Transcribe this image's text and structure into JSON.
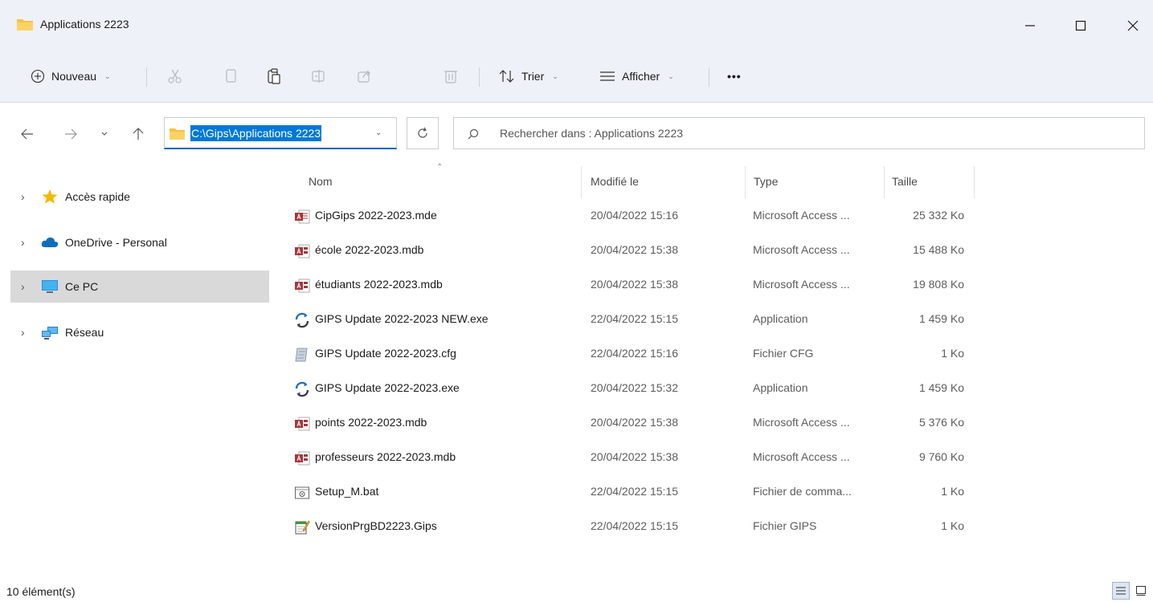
{
  "window": {
    "title": "Applications 2223",
    "minimize_icon": "minimize-icon",
    "maximize_icon": "maximize-icon",
    "close_icon": "close-icon"
  },
  "toolbar": {
    "new_label": "Nouveau",
    "sort_label": "Trier",
    "view_label": "Afficher",
    "more_label": "•••",
    "icons": [
      "plus-circle-icon",
      "cut-icon",
      "copy-icon",
      "paste-icon",
      "rename-icon",
      "share-icon",
      "delete-icon",
      "sort-icon",
      "view-icon",
      "more-icon"
    ]
  },
  "navigation": {
    "address": "C:\\Gips\\Applications 2223",
    "search_placeholder": "Rechercher dans : Applications 2223"
  },
  "sidebar": {
    "items": [
      {
        "label": "Accès rapide",
        "icon": "star-icon"
      },
      {
        "label": "OneDrive - Personal",
        "icon": "cloud-icon"
      },
      {
        "label": "Ce PC",
        "icon": "computer-icon",
        "selected": true
      },
      {
        "label": "Réseau",
        "icon": "network-icon"
      }
    ]
  },
  "file_list": {
    "columns": {
      "name": "Nom",
      "modified": "Modifié le",
      "type": "Type",
      "size": "Taille"
    },
    "files": [
      {
        "name": "CipGips 2022-2023.mde",
        "modified": "20/04/2022 15:16",
        "type": "Microsoft Access ...",
        "size": "25 332 Ko",
        "icon": "access-mde-icon"
      },
      {
        "name": "école 2022-2023.mdb",
        "modified": "20/04/2022 15:38",
        "type": "Microsoft Access ...",
        "size": "15 488 Ko",
        "icon": "access-mdb-icon"
      },
      {
        "name": "étudiants 2022-2023.mdb",
        "modified": "20/04/2022 15:38",
        "type": "Microsoft Access ...",
        "size": "19 808 Ko",
        "icon": "access-mdb-icon"
      },
      {
        "name": "GIPS Update 2022-2023 NEW.exe",
        "modified": "22/04/2022 15:15",
        "type": "Application",
        "size": "1 459 Ko",
        "icon": "update-app-icon"
      },
      {
        "name": "GIPS Update 2022-2023.cfg",
        "modified": "22/04/2022 15:16",
        "type": "Fichier CFG",
        "size": "1 Ko",
        "icon": "cfg-file-icon"
      },
      {
        "name": "GIPS Update 2022-2023.exe",
        "modified": "20/04/2022 15:32",
        "type": "Application",
        "size": "1 459 Ko",
        "icon": "update-app-icon"
      },
      {
        "name": "points 2022-2023.mdb",
        "modified": "20/04/2022 15:38",
        "type": "Microsoft Access ...",
        "size": "5 376 Ko",
        "icon": "access-mdb-icon"
      },
      {
        "name": "professeurs 2022-2023.mdb",
        "modified": "20/04/2022 15:38",
        "type": "Microsoft Access ...",
        "size": "9 760 Ko",
        "icon": "access-mdb-icon"
      },
      {
        "name": "Setup_M.bat",
        "modified": "22/04/2022 15:15",
        "type": "Fichier de comma...",
        "size": "1 Ko",
        "icon": "batch-file-icon"
      },
      {
        "name": "VersionPrgBD2223.Gips",
        "modified": "22/04/2022 15:15",
        "type": "Fichier GIPS",
        "size": "1 Ko",
        "icon": "notepad-file-icon"
      }
    ]
  },
  "status": {
    "count": "10 élément(s)"
  },
  "colors": {
    "accent": "#0078d7",
    "titlebar_bg": "#eef1f7",
    "folder": "#f6c243",
    "access_red": "#a4373a",
    "selected_bg": "#d9d9d9"
  }
}
